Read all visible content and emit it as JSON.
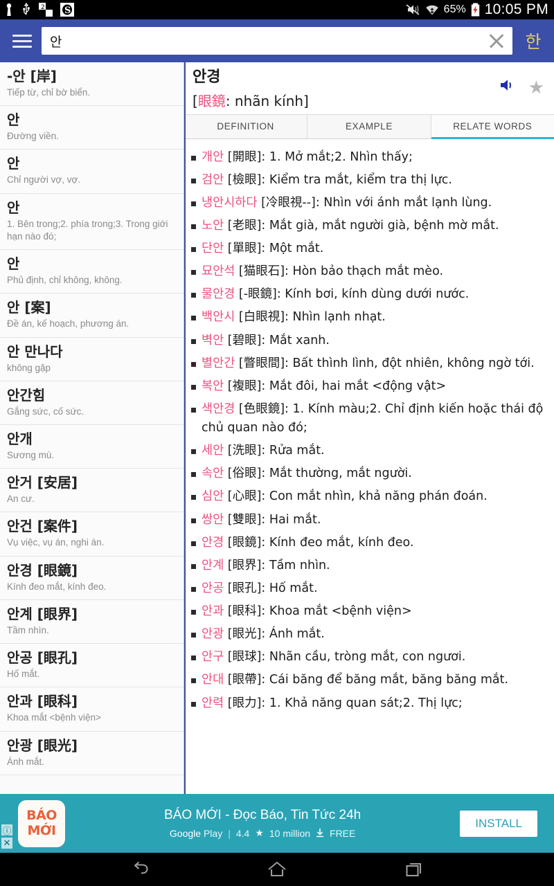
{
  "status_bar": {
    "icons": [
      "keyguard-icon",
      "usb-icon",
      "sd-card-icon",
      "app-badge-icon"
    ],
    "mute_icon": "volume-mute-icon",
    "wifi_icon": "wifi-icon",
    "battery_text": "65%",
    "battery_icon": "battery-charging-icon",
    "time": "10:05 PM"
  },
  "app_bar": {
    "menu_icon": "hamburger-menu-icon",
    "search_value": "안",
    "search_placeholder": "",
    "clear_icon": "clear-x-icon",
    "lang_toggle": "한"
  },
  "word_list": [
    {
      "term": "-안 [岸]",
      "definition": "Tiếp từ, chỉ bờ biển."
    },
    {
      "term": "안",
      "definition": "Đường viền."
    },
    {
      "term": "안",
      "definition": "Chỉ người vợ, vợ."
    },
    {
      "term": "안",
      "definition": "1. Bên trong;2. phía trong;3. Trong giới hạn nào đó;"
    },
    {
      "term": "안",
      "definition": "Phủ định, chỉ không, không."
    },
    {
      "term": "안 [案]",
      "definition": "Đề án, kế hoạch, phương án."
    },
    {
      "term": "안 만나다",
      "definition": "không gặp"
    },
    {
      "term": "안간힘",
      "definition": "Gắng sức, cố sức."
    },
    {
      "term": "안개",
      "definition": "Sương mù."
    },
    {
      "term": "안거 [安居]",
      "definition": "An cư."
    },
    {
      "term": "안건 [案件]",
      "definition": "Vụ việc, vụ án, nghi án."
    },
    {
      "term": "안경 [眼鏡]",
      "definition": "Kính đeo mắt, kính đeo."
    },
    {
      "term": "안계 [眼界]",
      "definition": "Tầm nhìn."
    },
    {
      "term": "안공 [眼孔]",
      "definition": "Hố mắt."
    },
    {
      "term": "안과 [眼科]",
      "definition": "Khoa mắt <bệnh viện>"
    },
    {
      "term": "안광 [眼光]",
      "definition": "Ánh mắt."
    }
  ],
  "detail": {
    "word": "안경",
    "hanja": "眼鏡",
    "reading": ": nhãn kính]",
    "bracket_open": "[",
    "speaker_icon": "speaker-icon",
    "star_icon": "star-icon",
    "tabs": [
      {
        "label": "DEFINITION",
        "active": false
      },
      {
        "label": "EXAMPLE",
        "active": false
      },
      {
        "label": "RELATE WORDS",
        "active": true
      }
    ],
    "related_words": [
      {
        "kr": "개안",
        "rest": " [開眼]: 1. Mở mắt;2. Nhìn thấy;"
      },
      {
        "kr": "검안",
        "rest": " [檢眼]: Kiểm tra mắt, kiểm tra thị lực."
      },
      {
        "kr": "냉안시하다",
        "rest": " [冷眼視--]: Nhìn với ánh mắt lạnh lùng."
      },
      {
        "kr": "노안",
        "rest": " [老眼]: Mắt già, mắt người già, bệnh mờ mắt."
      },
      {
        "kr": "단안",
        "rest": " [單眼]: Một mắt."
      },
      {
        "kr": "묘안석",
        "rest": " [猫眼石]: Hòn bảo thạch mắt mèo."
      },
      {
        "kr": "물안경",
        "rest": " [-眼鏡]: Kính bơi, kính dùng dưới nước."
      },
      {
        "kr": "백안시",
        "rest": " [白眼視]: Nhìn lạnh nhạt."
      },
      {
        "kr": "벽안",
        "rest": " [碧眼]: Mắt xanh."
      },
      {
        "kr": "별안간",
        "rest": " [瞥眼間]: Bất thình lình, đột nhiên, không ngờ tới."
      },
      {
        "kr": "복안",
        "rest": " [複眼]: Mắt đôi, hai mắt <động vật>"
      },
      {
        "kr": "색안경",
        "rest": " [色眼鏡]: 1. Kính màu;2. Chỉ định kiến hoặc thái độ chủ quan nào đó;"
      },
      {
        "kr": "세안",
        "rest": " [洗眼]: Rửa mắt."
      },
      {
        "kr": "속안",
        "rest": " [俗眼]: Mắt thường, mắt người."
      },
      {
        "kr": "심안",
        "rest": " [心眼]: Con mắt nhìn, khả năng phán đoán."
      },
      {
        "kr": "쌍안",
        "rest": " [雙眼]: Hai mắt."
      },
      {
        "kr": "안경",
        "rest": " [眼鏡]: Kính đeo mắt, kính đeo."
      },
      {
        "kr": "안계",
        "rest": " [眼界]: Tầm nhìn."
      },
      {
        "kr": "안공",
        "rest": " [眼孔]: Hố mắt."
      },
      {
        "kr": "안과",
        "rest": " [眼科]: Khoa mắt <bệnh viện>"
      },
      {
        "kr": "안광",
        "rest": " [眼光]: Ánh mắt."
      },
      {
        "kr": "안구",
        "rest": " [眼球]: Nhãn cầu, tròng mắt, con ngươi."
      },
      {
        "kr": "안대",
        "rest": " [眼帶]: Cái băng để băng mắt, băng băng mắt."
      },
      {
        "kr": "안력",
        "rest": " [眼力]: 1. Khả năng quan sát;2. Thị lực;"
      }
    ]
  },
  "ad": {
    "info_badge": "ⓘ",
    "close_badge": "✕",
    "logo_line1": "BÁO",
    "logo_line2": "MỚI",
    "title": "BÁO MỚI - Đọc Báo, Tin Tức 24h",
    "store": "Google",
    "store_light": "Play",
    "rating": "4.4",
    "rating_star": "★",
    "downloads": "10 million",
    "download_icon": "download-icon",
    "price": "FREE",
    "install_label": "INSTALL"
  },
  "nav_bar": {
    "back_icon": "back-icon",
    "home_icon": "home-icon",
    "recents_icon": "recent-apps-icon"
  },
  "colors": {
    "appbar": "#3b4ea8",
    "accent_pink": "#ef4f7c",
    "tab_indicator": "#29b6d8",
    "ad_bg": "#2aa3b5",
    "lang_gold": "#e3c86a"
  }
}
